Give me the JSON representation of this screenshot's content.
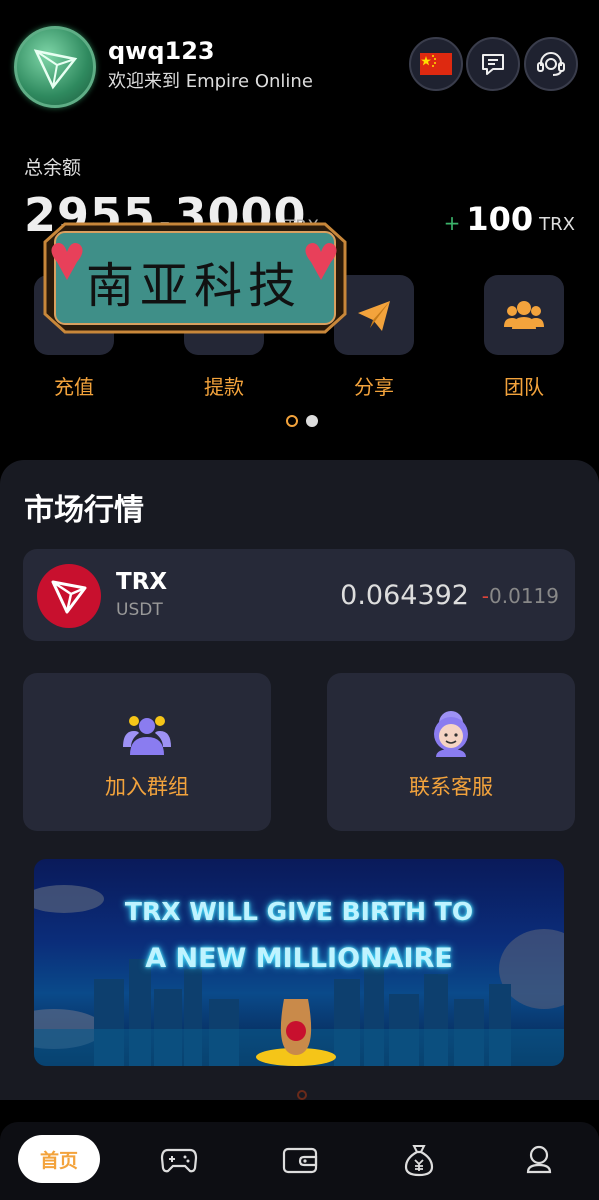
{
  "header": {
    "username": "qwq123",
    "welcome": "欢迎来到 Empire Online",
    "buttons": [
      "language-flag",
      "message-icon",
      "support-headset-icon"
    ]
  },
  "balance": {
    "label": "总余额",
    "value": "2955.3000",
    "unit": "TRX",
    "bonus_sign": "+",
    "bonus_amount": "100",
    "bonus_unit": "TRX"
  },
  "quick_actions": [
    {
      "label": "充值",
      "icon": "deposit-icon"
    },
    {
      "label": "提款",
      "icon": "withdraw-icon"
    },
    {
      "label": "分享",
      "icon": "paper-plane-icon"
    },
    {
      "label": "团队",
      "icon": "team-icon"
    }
  ],
  "watermark_text": "南亚科技",
  "market": {
    "title": "市场行情",
    "ticker": {
      "base": "TRX",
      "quote": "USDT",
      "price": "0.064392",
      "change_sign": "-",
      "change_value": "0.0119"
    }
  },
  "cards": [
    {
      "label": "加入群组",
      "icon": "group-icon"
    },
    {
      "label": "联系客服",
      "icon": "customer-service-icon"
    }
  ],
  "banner": {
    "line1": "TRX WILL GIVE BIRTH  TO",
    "line2": "A NEW MILLIONAIRE"
  },
  "nav": {
    "home_label": "首页",
    "items": [
      "gamepad-icon",
      "wallet-icon",
      "money-bag-icon",
      "profile-icon"
    ]
  },
  "colors": {
    "accent": "#f3a33c",
    "background": "#000000",
    "panel": "#181a22",
    "card": "#262938",
    "negative": "#e0443a",
    "positive": "#3bb36a"
  }
}
